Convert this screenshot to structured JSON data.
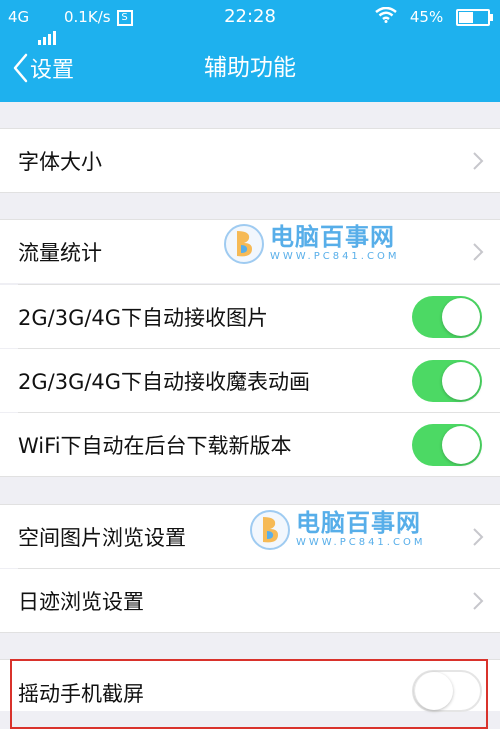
{
  "status_bar": {
    "network": "4G",
    "speed": "0.1K/s",
    "speed_icon": "S",
    "time": "22:28",
    "battery": "45%",
    "battery_level": 0.45
  },
  "nav": {
    "back_label": "设置",
    "title": "辅助功能"
  },
  "settings": {
    "font_size": "字体大小",
    "traffic_stats": "流量统计",
    "auto_receive_images": "2G/3G/4G下自动接收图片",
    "auto_receive_magic": "2G/3G/4G下自动接收魔表动画",
    "wifi_auto_download": "WiFi下自动在后台下载新版本",
    "space_image_browse": "空间图片浏览设置",
    "footprint_browse": "日迹浏览设置",
    "shake_screenshot": "摇动手机截屏"
  },
  "toggles": {
    "auto_receive_images": true,
    "auto_receive_magic": true,
    "wifi_auto_download": true,
    "shake_screenshot": false
  },
  "watermark": {
    "brand": "电脑百事网",
    "url": "WWW.PC841.COM"
  },
  "colors": {
    "header": "#1eb1ee",
    "toggle_on": "#4cd964",
    "highlight": "#d9322b"
  }
}
